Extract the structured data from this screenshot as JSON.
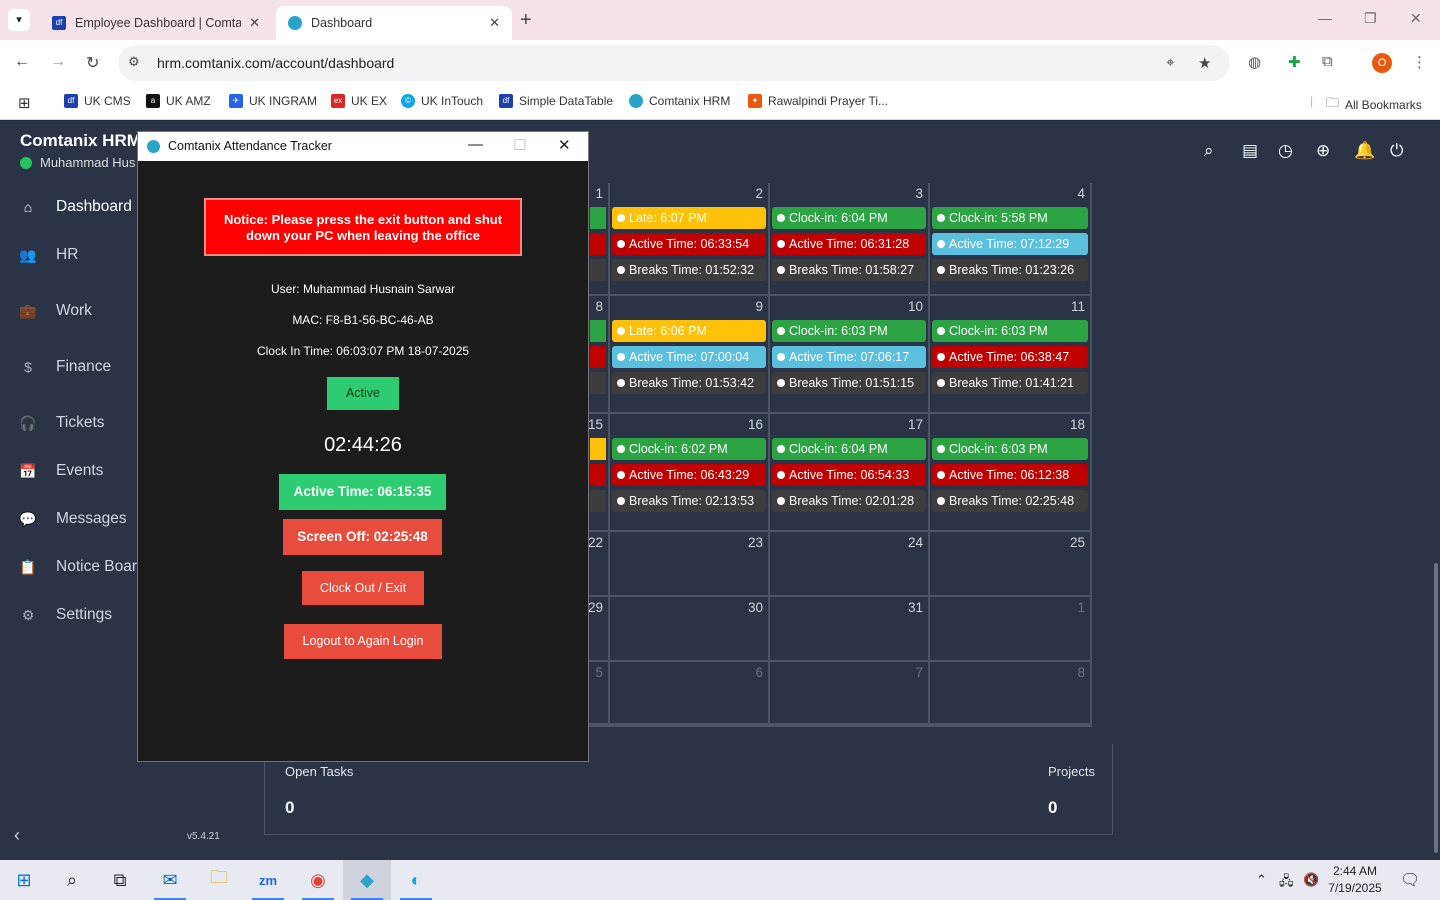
{
  "browser": {
    "tabs": [
      {
        "title": "Employee Dashboard | Comtanix",
        "favicon_color": "#1e40af",
        "favicon_text": "df"
      },
      {
        "title": "Dashboard",
        "favicon_color": "#2aa3c9",
        "favicon_text": ""
      }
    ],
    "address": "hrm.comtanix.com/account/dashboard",
    "profile_initial": "O",
    "bookmarks": [
      {
        "label": "UK CMS",
        "color": "#1e40af",
        "icon_text": "df"
      },
      {
        "label": "UK AMZ",
        "color": "#111111",
        "icon_text": "a"
      },
      {
        "label": "UK INGRAM",
        "color": "#2563eb",
        "icon_text": "✈"
      },
      {
        "label": "UK EX",
        "color": "#dc2626",
        "icon_text": "ex"
      },
      {
        "label": "UK InTouch",
        "color": "#0ea5e9",
        "icon_text": "©"
      },
      {
        "label": "Simple DataTable",
        "color": "#1e40af",
        "icon_text": "df"
      },
      {
        "label": "Comtanix HRM",
        "color": "#2aa3c9",
        "icon_text": ""
      },
      {
        "label": "Rawalpindi Prayer Ti...",
        "color": "#ea580c",
        "icon_text": "🕌"
      }
    ],
    "all_bookmarks": "All Bookmarks"
  },
  "app": {
    "brand": "Comtanix HRM",
    "user_name": "Muhammad Hus",
    "nav": [
      {
        "label": "Dashboard",
        "icon": "home-icon",
        "glyph": "⌂"
      },
      {
        "label": "HR",
        "icon": "users-icon",
        "glyph": "👥"
      },
      {
        "label": "Work",
        "icon": "briefcase-icon",
        "glyph": "💼"
      },
      {
        "label": "Finance",
        "icon": "dollar-icon",
        "glyph": "$"
      },
      {
        "label": "Tickets",
        "icon": "headset-icon",
        "glyph": "🎧"
      },
      {
        "label": "Events",
        "icon": "calendar-icon",
        "glyph": "📅"
      },
      {
        "label": "Messages",
        "icon": "message-icon",
        "glyph": "💬"
      },
      {
        "label": "Notice Board",
        "icon": "clipboard-icon",
        "glyph": "📋"
      },
      {
        "label": "Settings",
        "icon": "gear-icon",
        "glyph": "⚙"
      }
    ],
    "version": "v5.4.21",
    "colors": {
      "clockin": "#2ca444",
      "late": "#ffc107",
      "active_red": "#c00000",
      "active_teal": "#5bc0de",
      "breaks": "#3d3d3d"
    }
  },
  "calendar": {
    "rows": [
      {
        "cells": [
          {
            "day": "1",
            "events": []
          },
          {
            "day": "2",
            "events": [
              {
                "text": "Late: 6:07 PM",
                "kind": "late"
              },
              {
                "text": "Active Time: 06:33:54",
                "kind": "active_red"
              },
              {
                "text": "Breaks Time: 01:52:32",
                "kind": "breaks"
              }
            ]
          },
          {
            "day": "3",
            "events": [
              {
                "text": "Clock-in: 6:04 PM",
                "kind": "clockin"
              },
              {
                "text": "Active Time: 06:31:28",
                "kind": "active_red"
              },
              {
                "text": "Breaks Time: 01:58:27",
                "kind": "breaks"
              }
            ]
          },
          {
            "day": "4",
            "events": [
              {
                "text": "Clock-in: 5:58 PM",
                "kind": "clockin"
              },
              {
                "text": "Active Time: 07:12:29",
                "kind": "active_teal"
              },
              {
                "text": "Breaks Time: 01:23:26",
                "kind": "breaks"
              }
            ]
          }
        ]
      },
      {
        "cells": [
          {
            "day": "8",
            "events": []
          },
          {
            "day": "9",
            "events": [
              {
                "text": "Late: 6:06 PM",
                "kind": "late"
              },
              {
                "text": "Active Time: 07:00:04",
                "kind": "active_teal"
              },
              {
                "text": "Breaks Time: 01:53:42",
                "kind": "breaks"
              }
            ]
          },
          {
            "day": "10",
            "events": [
              {
                "text": "Clock-in: 6:03 PM",
                "kind": "clockin"
              },
              {
                "text": "Active Time: 07:06:17",
                "kind": "active_teal"
              },
              {
                "text": "Breaks Time: 01:51:15",
                "kind": "breaks"
              }
            ]
          },
          {
            "day": "11",
            "events": [
              {
                "text": "Clock-in: 6:03 PM",
                "kind": "clockin"
              },
              {
                "text": "Active Time: 06:38:47",
                "kind": "active_red"
              },
              {
                "text": "Breaks Time: 01:41:21",
                "kind": "breaks"
              }
            ]
          }
        ]
      },
      {
        "cells": [
          {
            "day": "15",
            "events": []
          },
          {
            "day": "16",
            "events": [
              {
                "text": "Clock-in: 6:02 PM",
                "kind": "clockin"
              },
              {
                "text": "Active Time: 06:43:29",
                "kind": "active_red"
              },
              {
                "text": "Breaks Time: 02:13:53",
                "kind": "breaks"
              }
            ]
          },
          {
            "day": "17",
            "events": [
              {
                "text": "Clock-in: 6:04 PM",
                "kind": "clockin"
              },
              {
                "text": "Active Time: 06:54:33",
                "kind": "active_red"
              },
              {
                "text": "Breaks Time: 02:01:28",
                "kind": "breaks"
              }
            ]
          },
          {
            "day": "18",
            "events": [
              {
                "text": "Clock-in: 6:03 PM",
                "kind": "clockin"
              },
              {
                "text": "Active Time: 06:12:38",
                "kind": "active_red"
              },
              {
                "text": "Breaks Time: 02:25:48",
                "kind": "breaks"
              }
            ]
          }
        ]
      },
      {
        "cells": [
          {
            "day": "22",
            "events": []
          },
          {
            "day": "23",
            "events": []
          },
          {
            "day": "24",
            "events": []
          },
          {
            "day": "25",
            "events": []
          }
        ]
      },
      {
        "cells": [
          {
            "day": "29",
            "events": []
          },
          {
            "day": "30",
            "events": []
          },
          {
            "day": "31",
            "events": []
          },
          {
            "day": "1",
            "events": [],
            "out": true
          }
        ]
      },
      {
        "cells": [
          {
            "day": "5",
            "events": [],
            "out": true
          },
          {
            "day": "6",
            "events": [],
            "out": true
          },
          {
            "day": "7",
            "events": [],
            "out": true
          },
          {
            "day": "8",
            "events": [],
            "out": true
          }
        ]
      }
    ]
  },
  "stats": {
    "open_tasks_label": "Open Tasks",
    "open_tasks_value": "0",
    "projects_label": "Projects",
    "projects_value": "0"
  },
  "tracker": {
    "title": "Comtanix Attendance Tracker",
    "notice": "Notice: Please press the exit button and shut down your PC when leaving the office",
    "user": "User: Muhammad Husnain Sarwar",
    "mac": "MAC: F8-B1-56-BC-46-AB",
    "clock_in": "Clock In Time: 06:03:07 PM 18-07-2025",
    "status": "Active",
    "timer": "02:44:26",
    "active_time": "Active Time: 06:15:35",
    "screen_off": "Screen Off: 02:25:48",
    "clock_out": "Clock Out / Exit",
    "logout": "Logout to Again Login"
  },
  "taskbar": {
    "time": "2:44 AM",
    "date": "7/19/2025",
    "apps": [
      "start-icon",
      "search-icon",
      "task-view-icon",
      "outlook-icon",
      "file-explorer-icon",
      "zoom-icon",
      "chrome-icon",
      "tracker-icon",
      "edge-icon"
    ]
  }
}
